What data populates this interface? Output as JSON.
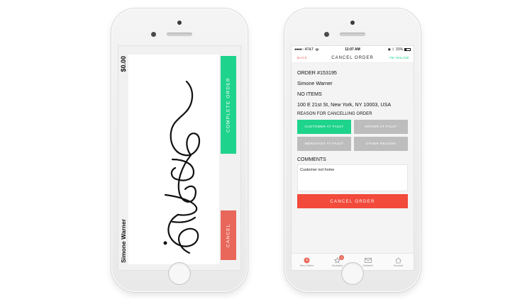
{
  "signature_screen": {
    "amount": "$0.00",
    "signer_name": "Simone Warner",
    "complete_label": "COMPLETE ORDER",
    "cancel_label": "CANCEL",
    "colors": {
      "complete": "#1ed38b",
      "cancel": "#e8675a"
    }
  },
  "status_bar": {
    "carrier": "AT&T",
    "time": "11:07 AM",
    "battery": "31%"
  },
  "nav": {
    "back_label": "BACK",
    "title": "CANCEL ORDER",
    "online_label": "I'M ONLINE"
  },
  "order": {
    "number": "ORDER #153195",
    "customer": "Simone Warner",
    "items": "NO ITEMS",
    "address": "100 E 21st St, New York, NY 10003, USA"
  },
  "reasons": {
    "label": "REASON FOR CANCELLING ORDER",
    "options": [
      {
        "label": "CUSTOMER AT FAULT",
        "selected": true
      },
      {
        "label": "DRIVER AT FAULT",
        "selected": false
      },
      {
        "label": "MERCHANT AT FAULT",
        "selected": false
      },
      {
        "label": "OTHER REASON",
        "selected": false
      }
    ]
  },
  "comments": {
    "label": "COMMENTS",
    "value": "Customer not home"
  },
  "cancel_button_label": "CANCEL ORDER",
  "tabs": [
    {
      "label": "New Orders",
      "icon": "clock-icon"
    },
    {
      "label": "Accepted",
      "icon": "star-icon",
      "badge": "3"
    },
    {
      "label": "Archived",
      "icon": "archive-icon"
    },
    {
      "label": "Account",
      "icon": "home-icon"
    }
  ],
  "colors": {
    "accent_green": "#1ed38b",
    "accent_red": "#f24a3b",
    "back_red": "#e8675a"
  }
}
